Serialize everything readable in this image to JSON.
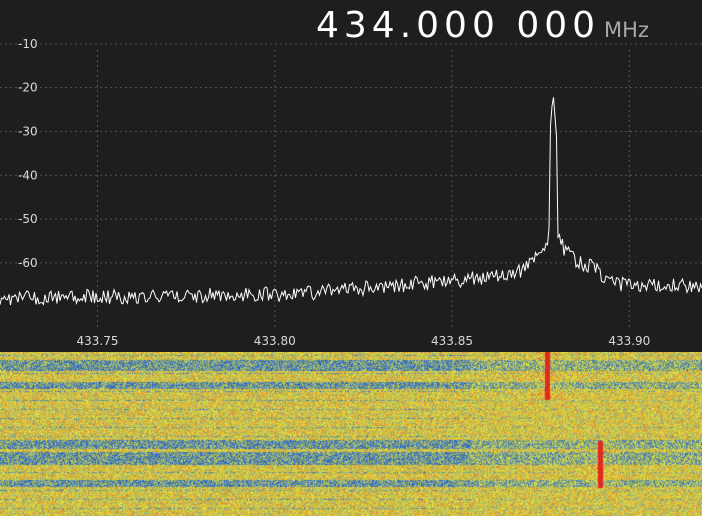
{
  "frequency_display": {
    "value": "434.000 000",
    "unit": "MHz"
  },
  "colors": {
    "background": "#1f1e1f",
    "trace": "#ffffff",
    "grid": "#555555",
    "axis_text": "#d8d8d8",
    "waterfall_low": "#1f5fd0",
    "waterfall_mid": "#e8e83a",
    "waterfall_high": "#e02020"
  },
  "chart_data": {
    "type": "line",
    "ylim": [
      -76,
      0
    ],
    "xlim": [
      433.7225,
      433.9205
    ],
    "y_ticks": [
      {
        "value": -10,
        "label": "-10"
      },
      {
        "value": -20,
        "label": "-20"
      },
      {
        "value": -30,
        "label": "-30"
      },
      {
        "value": -40,
        "label": "-40"
      },
      {
        "value": -50,
        "label": "-50"
      },
      {
        "value": -60,
        "label": "-60"
      }
    ],
    "x_ticks": [
      {
        "value": 433.75,
        "label": "433.75"
      },
      {
        "value": 433.8,
        "label": "433.80"
      },
      {
        "value": 433.85,
        "label": "433.85"
      },
      {
        "value": 433.9,
        "label": "433.90"
      }
    ],
    "grid": true,
    "peak": {
      "x": 433.8785,
      "y": -21
    }
  }
}
